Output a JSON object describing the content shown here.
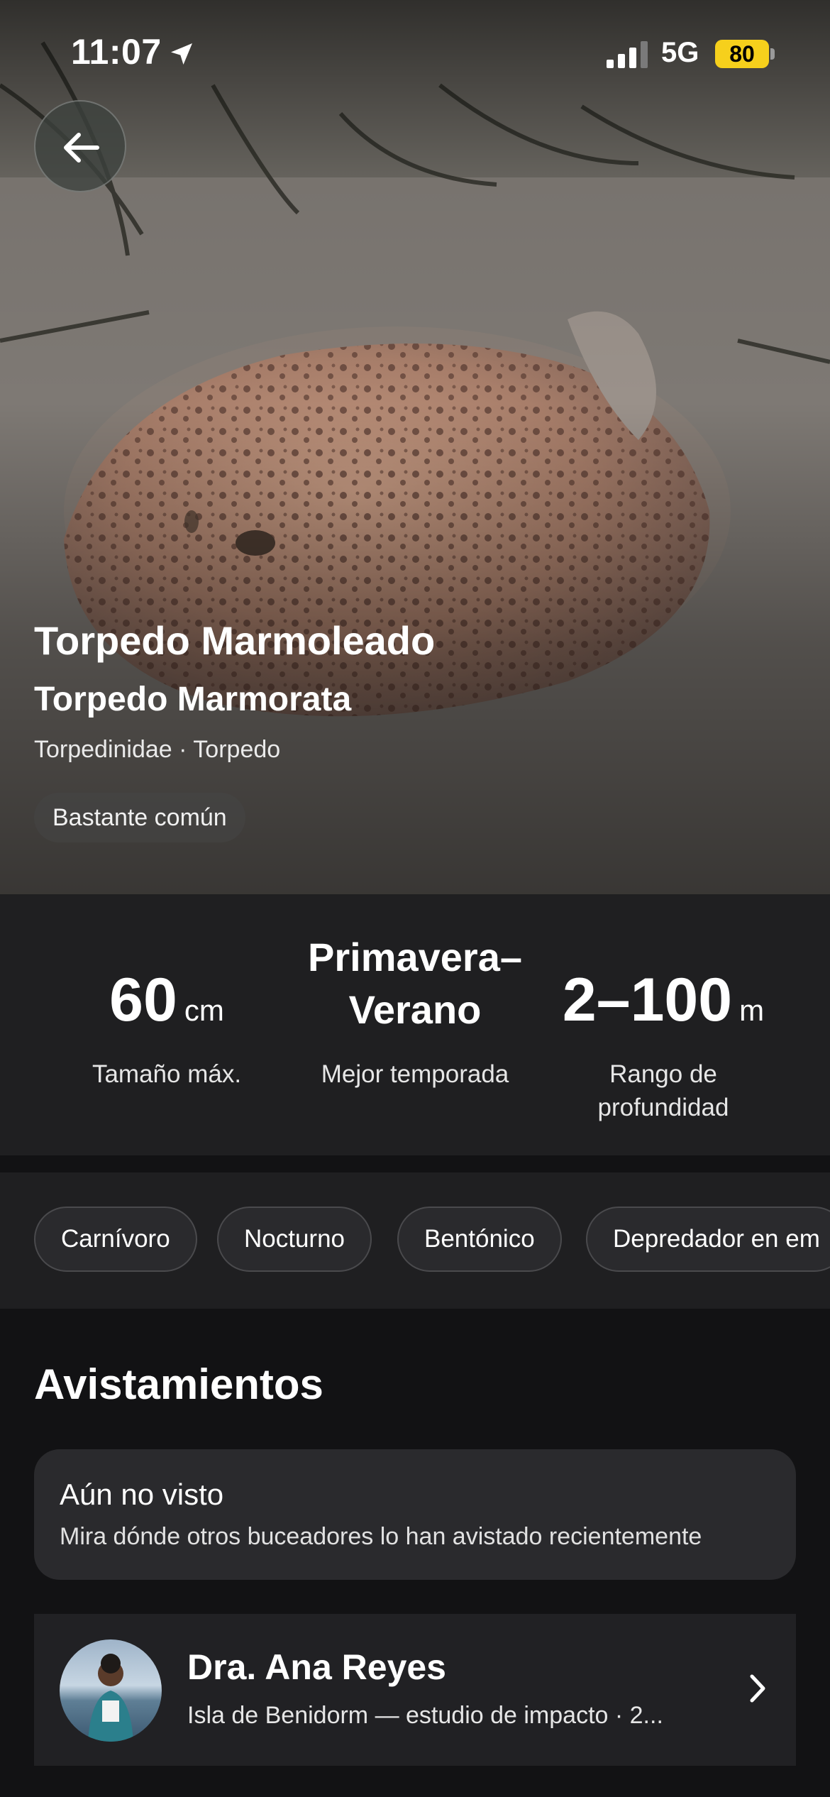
{
  "status_bar": {
    "time": "11:07",
    "network": "5G",
    "battery": "80"
  },
  "species": {
    "common_name": "Torpedo Marmoleado",
    "scientific_name": "Torpedo Marmorata",
    "taxonomy": "Torpedinidae · Torpedo",
    "abundance": "Bastante común"
  },
  "stats": {
    "size": {
      "value": "60",
      "unit": "cm",
      "label": "Tamaño máx."
    },
    "season": {
      "line1": "Primavera–",
      "line2": "Verano",
      "label": "Mejor temporada"
    },
    "depth": {
      "value": "2–100",
      "unit": "m",
      "label_line1": "Rango de",
      "label_line2": "profundidad"
    }
  },
  "tags": [
    "Carnívoro",
    "Nocturno",
    "Bentónico",
    "Depredador en em"
  ],
  "sightings": {
    "title": "Avistamientos",
    "empty_title": "Aún no visto",
    "empty_subtitle": "Mira dónde otros buceadores lo han avistado recientemente",
    "entries": [
      {
        "name": "Dra. Ana Reyes",
        "description": "Isla de Benidorm — estudio de impacto · 2..."
      }
    ]
  },
  "icons": {
    "back": "arrow-left-icon",
    "location": "location-arrow-icon",
    "signal": "cellular-signal-icon",
    "chevron": "chevron-right-icon"
  },
  "colors": {
    "battery": "#f6d01c",
    "background": "#121214",
    "card": "#2a2a2d"
  }
}
